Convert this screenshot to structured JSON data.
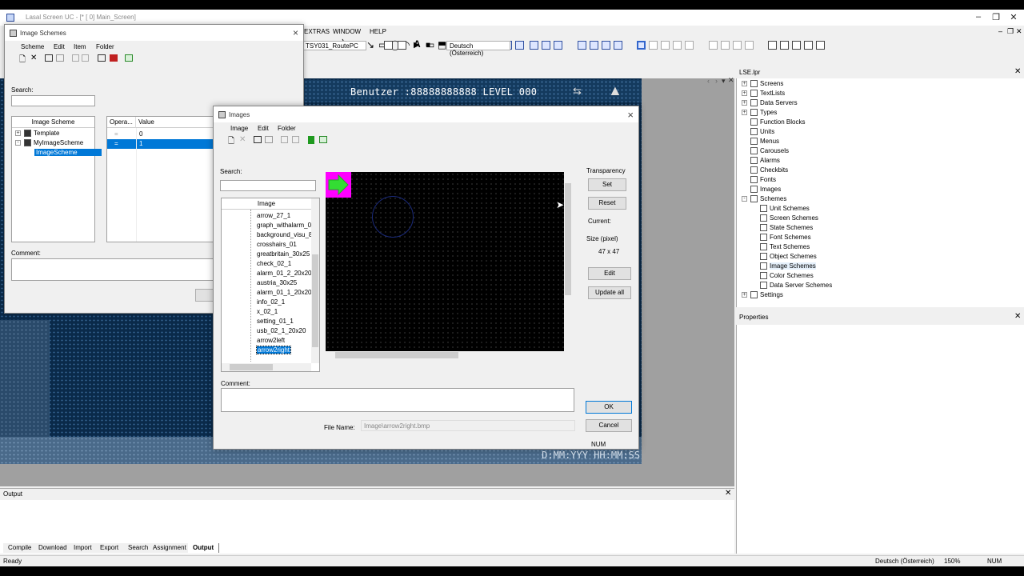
{
  "main_window": {
    "title": "Lasal Screen UC - [* [ 0] Main_Screen]",
    "menus": [
      "EXTRAS",
      "WINDOW",
      "HELP"
    ],
    "route_combo": "TSY031_RoutePC",
    "language_combo": "Deutsch (Österreich)"
  },
  "canvas": {
    "header_text": "Benutzer  :88888888888 LEVEL  000",
    "footer_text": "D:MM:YYY HH:MM:SS"
  },
  "project_tree": {
    "tab_label": "LSE.lpr",
    "items": [
      {
        "label": "Screens",
        "icon": "screen-icon",
        "expand": "+",
        "level": 0
      },
      {
        "label": "TextLists",
        "icon": "textlist-icon",
        "expand": "+",
        "level": 0
      },
      {
        "label": "Data Servers",
        "icon": "dataserver-icon",
        "expand": "+",
        "level": 0
      },
      {
        "label": "Types",
        "icon": "types-icon",
        "expand": "+",
        "level": 0
      },
      {
        "label": "Function Blocks",
        "icon": "function-block-icon",
        "expand": "",
        "level": 0
      },
      {
        "label": "Units",
        "icon": "units-icon",
        "expand": "",
        "level": 0
      },
      {
        "label": "Menus",
        "icon": "menu-icon",
        "expand": "",
        "level": 0
      },
      {
        "label": "Carousels",
        "icon": "carousel-icon",
        "expand": "",
        "level": 0
      },
      {
        "label": "Alarms",
        "icon": "alarm-icon",
        "expand": "",
        "level": 0
      },
      {
        "label": "Checkbits",
        "icon": "checkbit-icon",
        "expand": "",
        "level": 0
      },
      {
        "label": "Fonts",
        "icon": "font-icon",
        "expand": "",
        "level": 0
      },
      {
        "label": "Images",
        "icon": "image-icon",
        "expand": "",
        "level": 0
      },
      {
        "label": "Schemes",
        "icon": "scheme-icon",
        "expand": "-",
        "level": 0
      },
      {
        "label": "Unit Schemes",
        "icon": "unit-scheme-icon",
        "expand": "",
        "level": 1
      },
      {
        "label": "Screen Schemes",
        "icon": "screen-scheme-icon",
        "expand": "",
        "level": 1
      },
      {
        "label": "State Schemes",
        "icon": "state-scheme-icon",
        "expand": "",
        "level": 1
      },
      {
        "label": "Font Schemes",
        "icon": "font-scheme-icon",
        "expand": "",
        "level": 1
      },
      {
        "label": "Text Schemes",
        "icon": "text-scheme-icon",
        "expand": "",
        "level": 1
      },
      {
        "label": "Object Schemes",
        "icon": "object-scheme-icon",
        "expand": "",
        "level": 1
      },
      {
        "label": "Image Schemes",
        "icon": "image-scheme-icon",
        "expand": "",
        "level": 1,
        "selected": true
      },
      {
        "label": "Color Schemes",
        "icon": "color-scheme-icon",
        "expand": "",
        "level": 1
      },
      {
        "label": "Data Server Schemes",
        "icon": "data-server-scheme-icon",
        "expand": "",
        "level": 1
      },
      {
        "label": "Settings",
        "icon": "settings-icon",
        "expand": "+",
        "level": 0
      }
    ]
  },
  "properties_panel": {
    "title": "Properties"
  },
  "output_panel": {
    "title": "Output",
    "tabs": [
      "Compile",
      "Download",
      "Import",
      "Export",
      "Search",
      "Assignment",
      "Output"
    ],
    "active_tab": "Output"
  },
  "statusbar": {
    "left": "Ready",
    "language": "Deutsch (Österreich)",
    "zoom": "150%",
    "num": "NUM"
  },
  "scheme_window": {
    "title": "Image Schemes",
    "menus": [
      "Scheme",
      "Edit",
      "Item",
      "Folder"
    ],
    "search_label": "Search:",
    "search_value": "",
    "tree_header": "Image Scheme",
    "tree": [
      {
        "label": "Template",
        "expand": "+",
        "level": 0
      },
      {
        "label": "MyImageScheme",
        "expand": "-",
        "level": 0
      },
      {
        "label": "ImageScheme",
        "expand": "",
        "level": 1,
        "selected": true
      }
    ],
    "table_headers": [
      "Opera...",
      "Value"
    ],
    "rows": [
      {
        "op": "=",
        "value": "0"
      },
      {
        "op": "=",
        "value": "1",
        "selected": true
      }
    ],
    "comment_label": "Comment:"
  },
  "images_window": {
    "title": "Images",
    "menus": [
      "Image",
      "Edit",
      "Folder"
    ],
    "search_label": "Search:",
    "search_value": "",
    "list_header": "Image",
    "list": [
      "arrow_27_1",
      "graph_withalarm_0",
      "background_visu_8",
      "crosshairs_01",
      "greatbritain_30x25",
      "check_02_1",
      "alarm_01_2_20x20",
      "austria_30x25",
      "alarm_01_1_20x20",
      "info_02_1",
      "x_02_1",
      "setting_01_1",
      "usb_02_1_20x20",
      "arrow2left",
      "arrow2right"
    ],
    "selected": "arrow2right",
    "transparency_label": "Transparency",
    "set_label": "Set",
    "reset_label": "Reset",
    "current_label": "Current:",
    "size_label": "Size (pixel)",
    "size_value": "47 x 47",
    "edit_label": "Edit",
    "update_all_label": "Update all",
    "comment_label": "Comment:",
    "file_name_label": "File Name:",
    "file_name_value": "Image\\arrow2right.bmp",
    "ok_label": "OK",
    "cancel_label": "Cancel",
    "num_label": "NUM"
  },
  "colors": {
    "accent": "#0078d7",
    "canvas_bg": "#0a2a4a",
    "preview_arrow": "#33dd33",
    "preview_bg": "#ff00ff"
  }
}
